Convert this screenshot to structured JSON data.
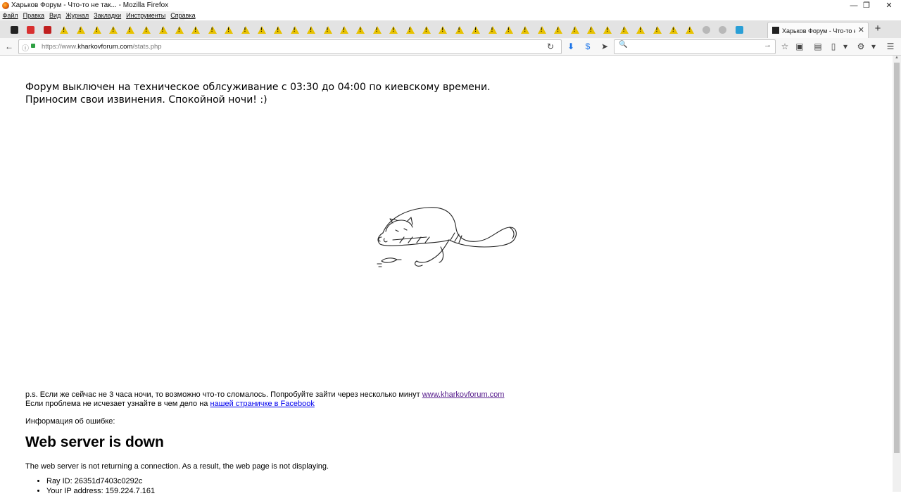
{
  "window": {
    "title": "Харьков Форум - Что-то не так... - Mozilla Firefox",
    "controls": {
      "minimize": "—",
      "restore": "❐",
      "close": "✕"
    }
  },
  "menu": [
    "Файл",
    "Правка",
    "Вид",
    "Журнал",
    "Закладки",
    "Инструменты",
    "Справка"
  ],
  "tabs": {
    "pinned_icons": [
      "site-icon",
      "site-icon",
      "site-icon",
      "warning-icon",
      "warning-icon",
      "warning-icon",
      "warning-icon",
      "warning-icon",
      "warning-icon",
      "warning-icon",
      "warning-icon",
      "warning-icon",
      "warning-icon",
      "warning-icon",
      "warning-icon",
      "warning-icon",
      "warning-icon",
      "warning-icon",
      "warning-icon",
      "warning-icon",
      "warning-icon",
      "warning-icon",
      "warning-icon",
      "warning-icon",
      "warning-icon",
      "warning-icon",
      "warning-icon",
      "warning-icon",
      "warning-icon",
      "warning-icon",
      "warning-icon",
      "warning-icon",
      "warning-icon",
      "warning-icon",
      "warning-icon",
      "warning-icon",
      "warning-icon",
      "warning-icon",
      "warning-icon",
      "warning-icon",
      "warning-icon",
      "warning-icon",
      "globe-icon",
      "globe-icon",
      "site-icon"
    ],
    "active_label": "Харьков Форум - Что-то н...",
    "close": "✕",
    "new_tab": "+"
  },
  "nav": {
    "back": "←",
    "url_prefix": "https://www.",
    "url_host": "kharkovforum.com",
    "url_path": "/stats.php",
    "reload": "↻",
    "search_placeholder": "",
    "search_go": "→"
  },
  "page": {
    "message_line1": "Форум выключен на техническое облсуживание с 03:30 до 04:00 по киевскому времени.",
    "message_line2": "Приносим свои извинения. Спокойной ночи! :)",
    "ps_text": "p.s. Если же сейчас не 3 часа ночи, то возможно что-то сломалось. Попробуйте зайти через несколько минут ",
    "ps_link": "www.kharkovforum.com",
    "ps_text2": "Если проблема не исчезает узнайте в чем дело на ",
    "ps_link2": "нашей страничке в Facebook",
    "error_info": "Информация об ошибке:",
    "error_heading": "Web server is down",
    "error_desc": "The web server is not returning a connection. As a result, the web page is not displaying.",
    "details": [
      "Ray ID: 26351d7403c0292c",
      "Your IP address: 159.224.7.161"
    ]
  }
}
